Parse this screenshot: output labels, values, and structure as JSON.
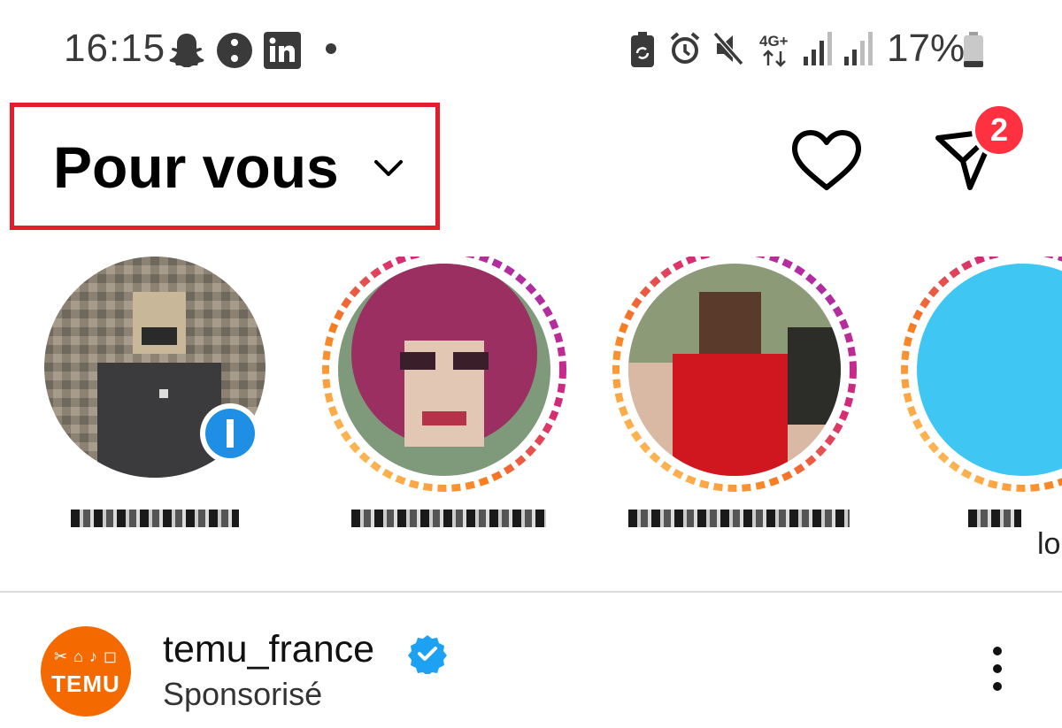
{
  "status_bar": {
    "time": "16:15",
    "battery_percent": "17%",
    "network": "4G+",
    "icons": [
      "snapchat-icon",
      "dots-app-icon",
      "linkedin-icon",
      "notification-dot",
      "battery-saver-icon",
      "alarm-icon",
      "mute-icon",
      "network-4g-icon",
      "signal-icon",
      "signal-icon-2",
      "battery-icon"
    ]
  },
  "header": {
    "title": "Pour vous",
    "badge_count": "2",
    "badge_color": "#ff3040",
    "highlight_color": "#e31d2b"
  },
  "stories": {
    "items": [
      {
        "label": "",
        "ring": false,
        "add_badge": true
      },
      {
        "label": "",
        "ring": true
      },
      {
        "label": "",
        "ring": true
      },
      {
        "label": "",
        "ring": true
      }
    ],
    "peek_label": "lo"
  },
  "post": {
    "username": "temu_france",
    "subtitle": "Sponsorisé",
    "avatar_text": "TEMU",
    "avatar_color": "#f56a00",
    "verified": true
  }
}
